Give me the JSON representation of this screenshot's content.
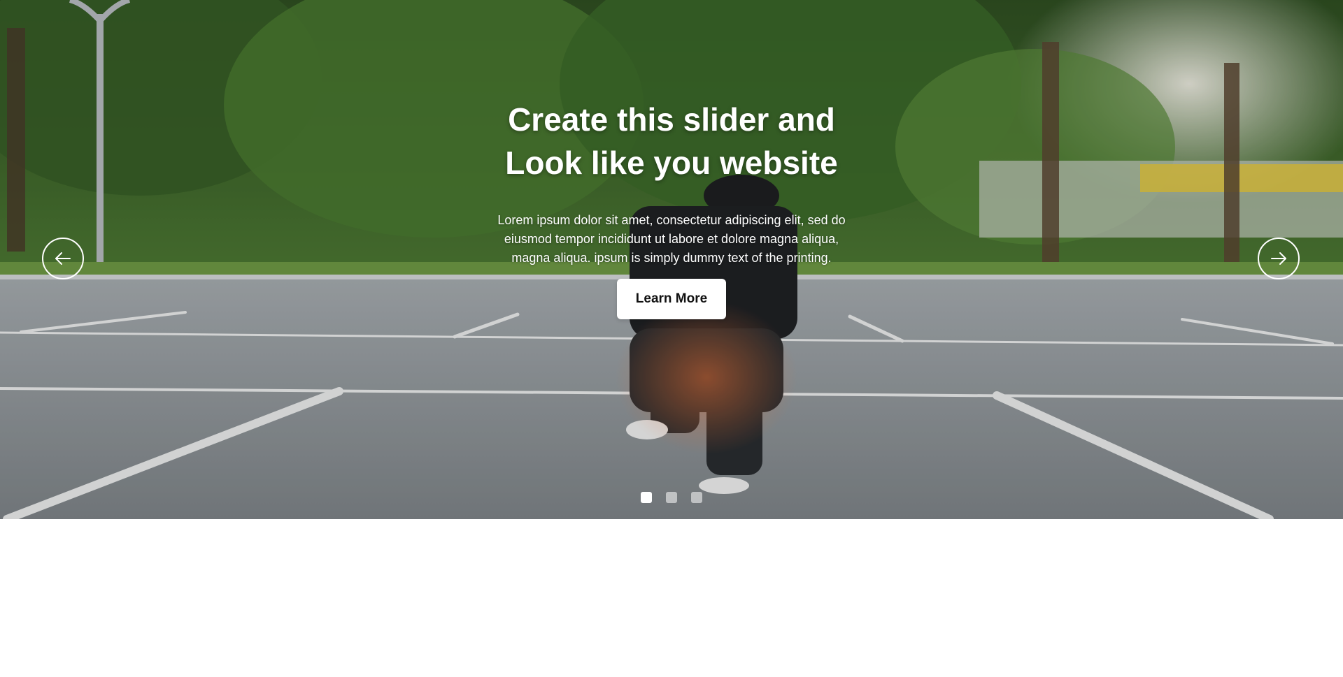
{
  "slider": {
    "title_line1": "Create this slider and",
    "title_line2": "Look like you website",
    "description_line1": "Lorem ipsum dolor sit amet, consectetur adipiscing elit, sed do",
    "description_line2": "eiusmod tempor incididunt ut labore et dolore magna aliqua,",
    "description_line3": "magna aliqua. ipsum is simply dummy text of the printing.",
    "button_label": "Learn More",
    "prev_icon": "arrow-left-icon",
    "next_icon": "arrow-right-icon",
    "dots": [
      {
        "state": "active"
      },
      {
        "state": "inactive"
      },
      {
        "state": "inactive"
      }
    ],
    "active_slide": 1
  },
  "colors": {
    "foliage": "#3f6b2c",
    "asphalt": "#8a9196",
    "button_bg": "#ffffff",
    "button_text": "#111111",
    "text": "#ffffff"
  }
}
